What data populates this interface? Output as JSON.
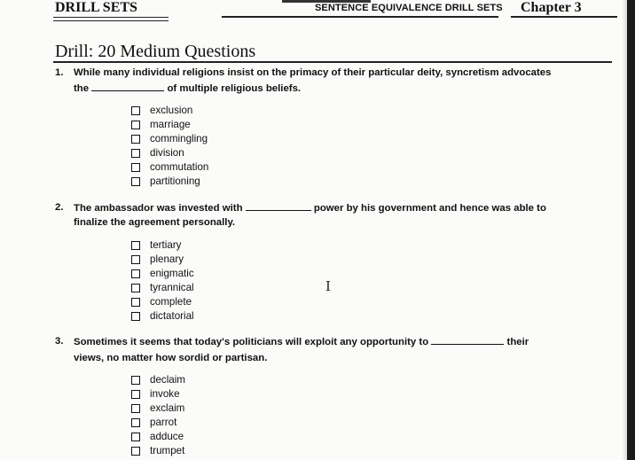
{
  "header": {
    "left": "DRILL SETS",
    "middle": "SENTENCE EQUIVALENCE DRILL SETS",
    "right": "Chapter 3"
  },
  "drill_title": "Drill: 20 Medium Questions",
  "questions": [
    {
      "number": "1.",
      "line1_a": "While many individual religions insist on the primacy of their particular deity, syncretism advocates",
      "line2_a": "the",
      "line2_b": "of multiple religious beliefs.",
      "options": [
        "exclusion",
        "marriage",
        "commingling",
        "division",
        "commutation",
        "partitioning"
      ]
    },
    {
      "number": "2.",
      "line1_a": "The ambassador was invested with",
      "line1_b": "power by his government and hence was able to",
      "line2_a": "finalize the agreement personally.",
      "options": [
        "tertiary",
        "plenary",
        "enigmatic",
        "tyrannical",
        "complete",
        "dictatorial"
      ]
    },
    {
      "number": "3.",
      "line1_a": "Sometimes it seems that today's politicians will exploit any opportunity to",
      "line1_b": "their",
      "line2_a": "views, no matter how sordid or partisan.",
      "options": [
        "declaim",
        "invoke",
        "exclaim",
        "parrot",
        "adduce",
        "trumpet"
      ]
    }
  ],
  "cursor_icon": "text-cursor-icon"
}
